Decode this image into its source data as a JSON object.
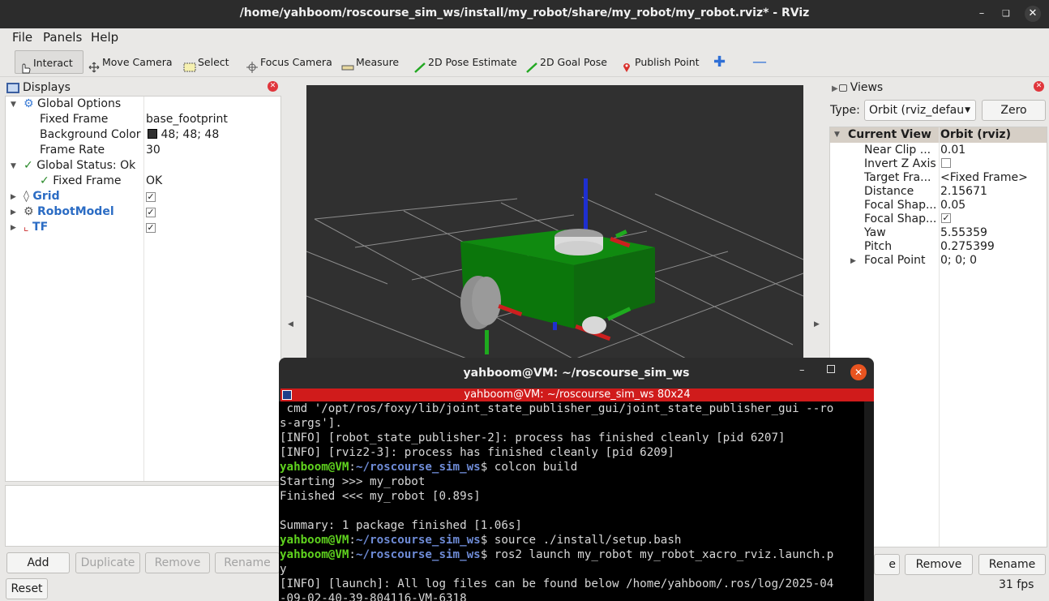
{
  "window": {
    "title": "/home/yahboom/roscourse_sim_ws/install/my_robot/share/my_robot/my_robot.rviz* - RViz"
  },
  "menu": {
    "file": "File",
    "panels": "Panels",
    "help": "Help"
  },
  "toolbar": {
    "interact": "Interact",
    "move_camera": "Move Camera",
    "select": "Select",
    "focus_camera": "Focus Camera",
    "measure": "Measure",
    "pose_estimate": "2D Pose Estimate",
    "goal_pose": "2D Goal Pose",
    "publish_point": "Publish Point"
  },
  "displays": {
    "title": "Displays",
    "global_options": "Global Options",
    "fixed_frame_label": "Fixed Frame",
    "fixed_frame_value": "base_footprint",
    "bg_color_label": "Background Color",
    "bg_color_value": "48; 48; 48",
    "frame_rate_label": "Frame Rate",
    "frame_rate_value": "30",
    "global_status": "Global Status: Ok",
    "status_fixed_frame": "Fixed Frame",
    "status_fixed_frame_value": "OK",
    "grid": "Grid",
    "robot_model": "RobotModel",
    "tf": "TF",
    "add": "Add",
    "duplicate": "Duplicate",
    "remove": "Remove",
    "rename": "Rename"
  },
  "views": {
    "title": "Views",
    "type_label": "Type:",
    "type_value": "Orbit (rviz_defau",
    "zero": "Zero",
    "current_view": "Current View",
    "current_view_value": "Orbit (rviz)",
    "props": [
      {
        "label": "Near Clip ...",
        "value": "0.01"
      },
      {
        "label": "Invert Z Axis",
        "value": ""
      },
      {
        "label": "Target Fra...",
        "value": "<Fixed Frame>"
      },
      {
        "label": "Distance",
        "value": "2.15671"
      },
      {
        "label": "Focal Shap...",
        "value": "0.05"
      },
      {
        "label": "Focal Shap...",
        "value": ""
      },
      {
        "label": "Yaw",
        "value": "5.55359"
      },
      {
        "label": "Pitch",
        "value": "0.275399"
      },
      {
        "label": "Focal Point",
        "value": "0; 0; 0"
      }
    ],
    "save_partial": "e",
    "remove": "Remove",
    "rename": "Rename"
  },
  "status": {
    "reset": "Reset",
    "fps": "31 fps"
  },
  "terminal": {
    "title": "yahboom@VM: ~/roscourse_sim_ws",
    "tab": "yahboom@VM: ~/roscourse_sim_ws 80x24",
    "prompt_user": "yahboom@VM",
    "prompt_path": "~/roscourse_sim_ws",
    "lines": [
      " cmd '/opt/ros/foxy/lib/joint_state_publisher_gui/joint_state_publisher_gui --ro",
      "s-args'].",
      "[INFO] [robot_state_publisher-2]: process has finished cleanly [pid 6207]",
      "[INFO] [rviz2-3]: process has finished cleanly [pid 6209]",
      "Starting >>> my_robot",
      "Finished <<< my_robot [0.89s]",
      "",
      "Summary: 1 package finished [1.06s]",
      "y",
      "[INFO] [launch]: All log files can be found below /home/yahboom/.ros/log/2025-04",
      "-09-02-40-39-804116-VM-6318"
    ],
    "cmd_build": "$ colcon build",
    "cmd_source": "$ source ./install/setup.bash",
    "cmd_launch": "$ ros2 launch my_robot my_robot_xacro_rviz.launch.p"
  },
  "colors": {
    "background": "#303030",
    "swatch": "#303030",
    "terminal_tab": "#d01b1b"
  }
}
